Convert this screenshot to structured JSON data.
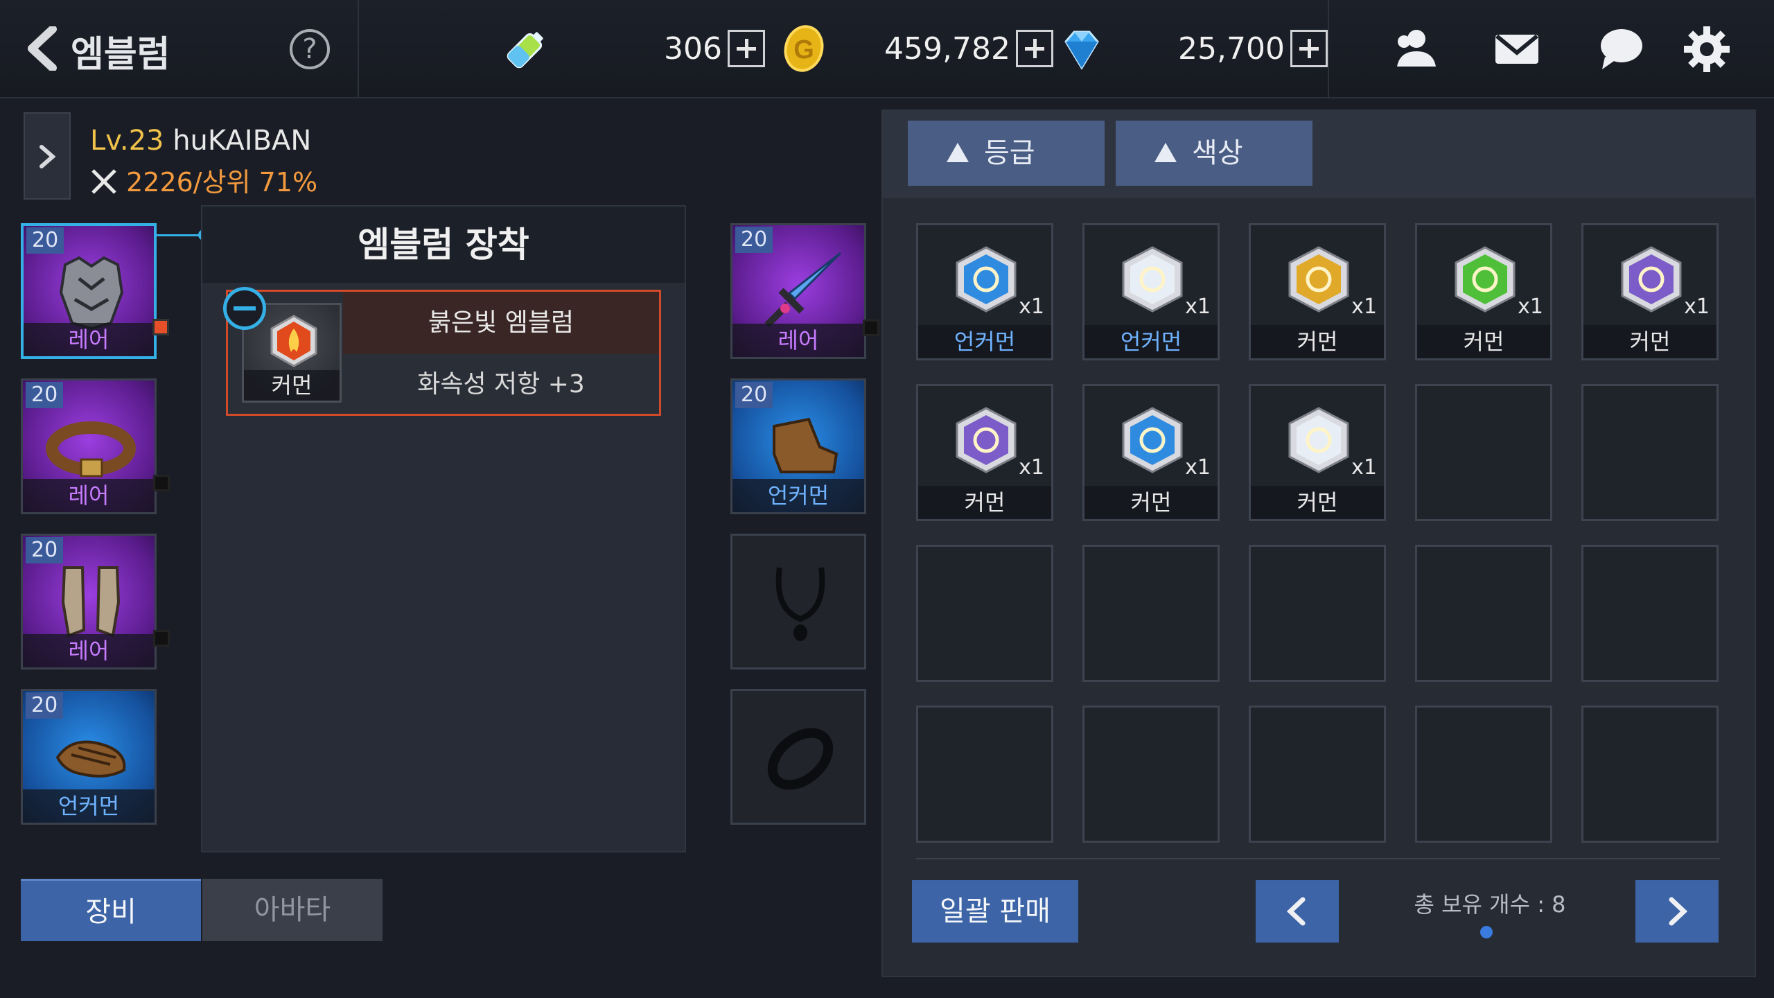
{
  "header": {
    "title": "엠블럼",
    "help": "?",
    "currencies": [
      {
        "icon": "energy-battery-icon",
        "value": "306"
      },
      {
        "icon": "gold-coin-icon",
        "value": "459,782"
      },
      {
        "icon": "diamond-gem-icon",
        "value": "25,700"
      }
    ],
    "right_icons": [
      "friends-icon",
      "mail-icon",
      "chat-icon",
      "settings-gear-icon"
    ]
  },
  "player": {
    "level": "Lv.23",
    "name": "huKAIBAN",
    "power": "2226/상위 71%"
  },
  "equipment_left": [
    {
      "level": "20",
      "grade": "레어",
      "icon": "armor-chest-icon",
      "selected": true,
      "mark": "red"
    },
    {
      "level": "20",
      "grade": "레어",
      "icon": "belt-icon",
      "selected": false,
      "mark": "dark"
    },
    {
      "level": "20",
      "grade": "레어",
      "icon": "leg-guards-icon",
      "selected": false,
      "mark": "dark"
    },
    {
      "level": "20",
      "grade": "언커먼",
      "icon": "gloves-icon",
      "selected": false,
      "mark": ""
    }
  ],
  "equipment_right": [
    {
      "level": "20",
      "grade": "레어",
      "icon": "sword-weapon-icon",
      "mark": "dark"
    },
    {
      "level": "20",
      "grade": "언커먼",
      "icon": "boots-icon",
      "mark": ""
    },
    {
      "level": "",
      "grade": "",
      "icon": "necklace-slot-icon"
    },
    {
      "level": "",
      "grade": "",
      "icon": "ring-slot-icon"
    }
  ],
  "emblem_panel": {
    "title": "엠블럼 장착",
    "emblem_name": "붉은빛 엠블럼",
    "emblem_grade": "커먼",
    "emblem_effect": "화속성 저항 +3"
  },
  "tabs": {
    "equip": "장비",
    "avatar": "아바타"
  },
  "inventory": {
    "sort_grade": "등급",
    "sort_color": "색상",
    "items": [
      {
        "grade": "언커먼",
        "qty": "x1",
        "icon": "blue-eye-emblem-icon",
        "tier": "uncommon",
        "color": "#2f8be0"
      },
      {
        "grade": "언커먼",
        "qty": "x1",
        "icon": "white-sword-emblem-icon",
        "tier": "uncommon",
        "color": "#e8eef5"
      },
      {
        "grade": "커먼",
        "qty": "x1",
        "icon": "gold-target-emblem-icon",
        "tier": "common",
        "color": "#e0a92a"
      },
      {
        "grade": "커먼",
        "qty": "x1",
        "icon": "green-cross-emblem-icon",
        "tier": "common",
        "color": "#4fbf3a"
      },
      {
        "grade": "커먼",
        "qty": "x1",
        "icon": "purple-wing-emblem-icon",
        "tier": "common",
        "color": "#7b5cc8"
      },
      {
        "grade": "커먼",
        "qty": "x1",
        "icon": "purple-party-emblem-icon",
        "tier": "common",
        "color": "#7b5cc8"
      },
      {
        "grade": "커먼",
        "qty": "x1",
        "icon": "blue-key-emblem-icon",
        "tier": "common",
        "color": "#2f8be0"
      },
      {
        "grade": "커먼",
        "qty": "x1",
        "icon": "white-fire-sword-emblem-icon",
        "tier": "common",
        "color": "#e8eef5"
      }
    ],
    "sell_all": "일괄 판매",
    "total_count": "총 보유 개수 : 8"
  }
}
